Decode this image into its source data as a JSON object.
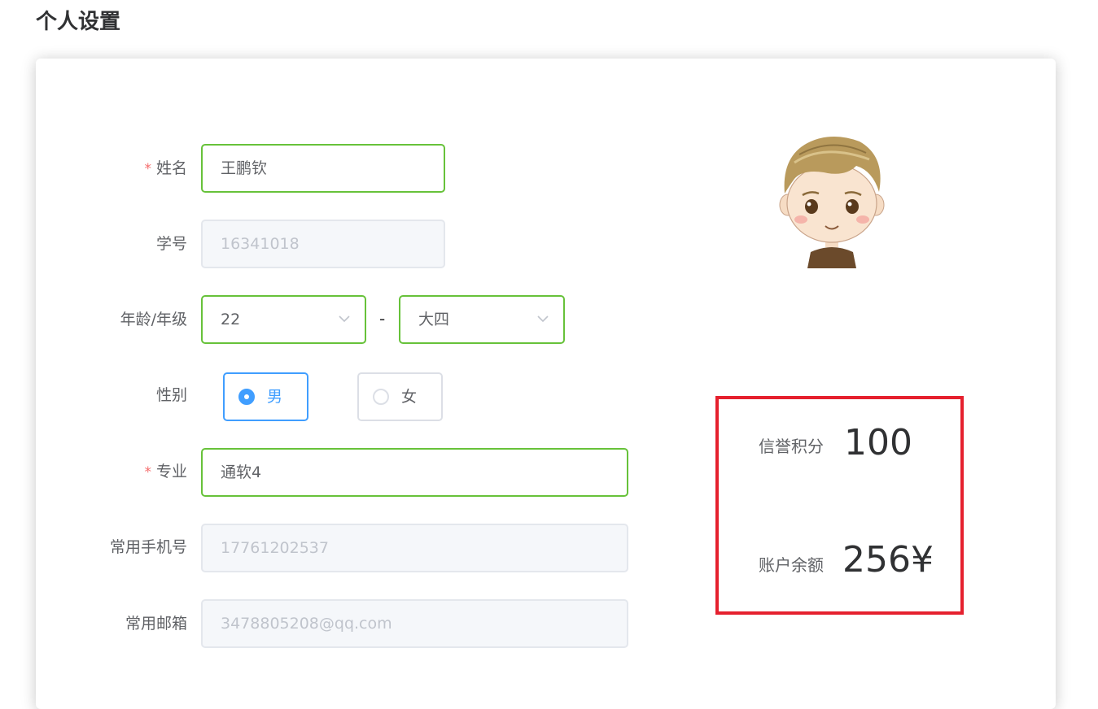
{
  "page": {
    "title": "个人设置"
  },
  "form": {
    "name": {
      "label": "姓名",
      "required_mark": "*",
      "value": "王鹏钦"
    },
    "student_id": {
      "label": "学号",
      "value": "16341018"
    },
    "age_grade": {
      "label": "年龄/年级",
      "age": "22",
      "separator": "-",
      "grade": "大四"
    },
    "gender": {
      "label": "性别",
      "options": [
        "男",
        "女"
      ],
      "selected": "男"
    },
    "major": {
      "label": "专业",
      "required_mark": "*",
      "value": "通软4"
    },
    "phone": {
      "label": "常用手机号",
      "value": "17761202537"
    },
    "email": {
      "label": "常用邮箱",
      "value": "3478805208@qq.com"
    }
  },
  "stats": {
    "credit": {
      "label": "信誉积分",
      "value": "100"
    },
    "balance": {
      "label": "账户余额",
      "value": "256¥"
    }
  },
  "colors": {
    "valid_border": "#67c23a",
    "radio_accent": "#409eff",
    "required_star": "#f56c6c",
    "highlight_box": "#e5202e"
  },
  "icons": {
    "select_arrow": "chevron-down-icon",
    "avatar": "cartoon-boy-avatar"
  }
}
